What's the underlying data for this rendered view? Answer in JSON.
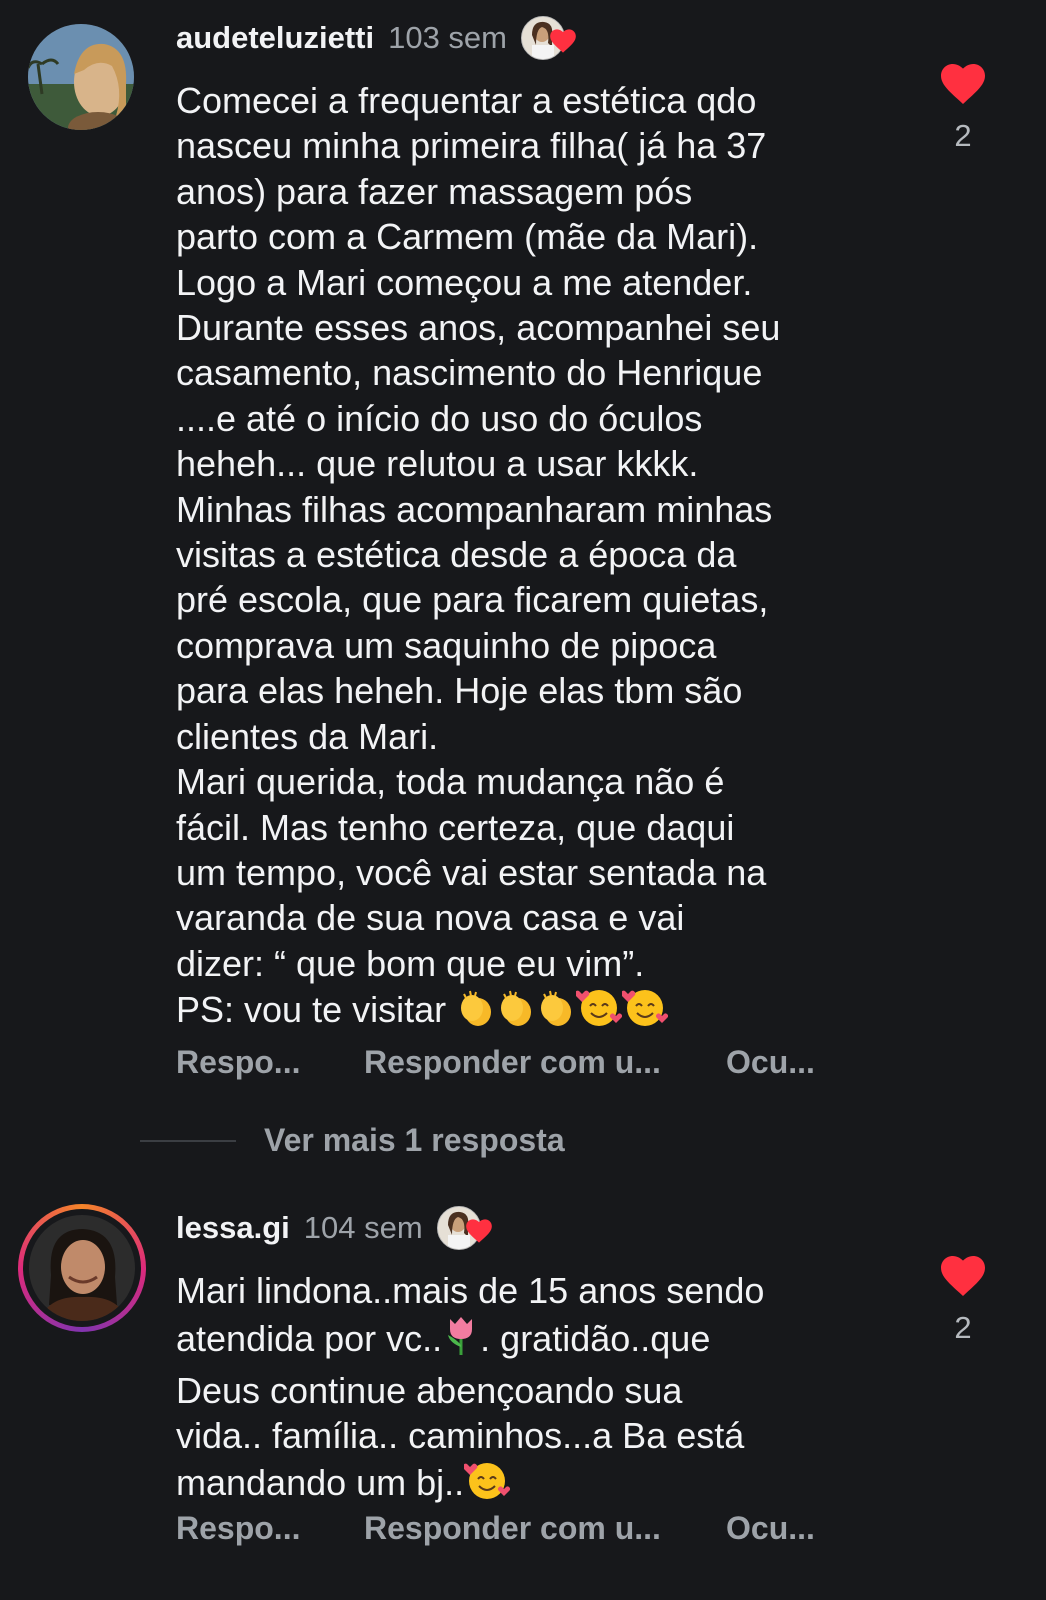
{
  "comments": [
    {
      "username": "audeteluzietti",
      "time": "103 sem",
      "text": "Comecei a frequentar a estética qdo\nnasceu minha primeira filha( já ha 37\nanos) para fazer massagem pós\nparto com a Carmem (mãe da Mari).\nLogo a Mari começou a me atender.\nDurante esses anos, acompanhei seu\ncasamento, nascimento do Henrique\n....e até o início do uso do óculos\nheheh... que relutou a usar kkkk.\nMinhas filhas acompanharam minhas\nvisitas a estética desde a época da\npré escola, que para ficarem quietas,\ncomprava um saquinho de pipoca\npara elas heheh. Hoje elas tbm são\nclientes da Mari.\nMari querida, toda mudança não é\nfácil. Mas tenho certeza, que daqui\num tempo, você vai estar sentada na\nvaranda de sua nova casa e vai\ndizer: “ que bom que eu vim”.",
      "last_line": "PS: vou te visitar",
      "like_count": "2",
      "actions": [
        "Respo...",
        "Responder com u...",
        "Ocu..."
      ]
    },
    {
      "username": "lessa.gi",
      "time": "104 sem",
      "line1": "Mari lindona..mais de 15 anos sendo",
      "line2a": "atendida por vc..",
      "line2b": ". gratidão..que",
      "line3": "Deus continue abençoando sua",
      "line4": "vida.. família.. caminhos...a Ba está",
      "line5": "mandando um bj..",
      "like_count": "2",
      "actions": [
        "Respo...",
        "Responder com u...",
        "Ocu..."
      ]
    }
  ],
  "more_replies": "Ver mais 1 resposta",
  "colors": {
    "heart": "#ff3040",
    "background": "#17181b",
    "muted": "#9ea3a9"
  },
  "icons": [
    "heart-icon",
    "clapping-hands-emoji",
    "smiling-face-with-hearts-emoji",
    "tulip-emoji"
  ]
}
